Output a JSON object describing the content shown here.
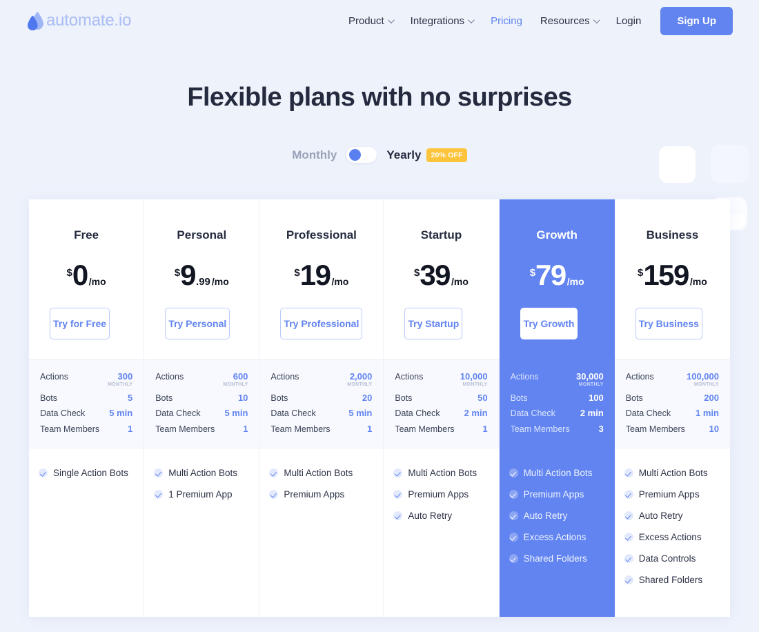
{
  "header": {
    "logo_text": "automate.io",
    "nav": [
      {
        "label": "Product",
        "has_caret": true,
        "active": false
      },
      {
        "label": "Integrations",
        "has_caret": true,
        "active": false
      },
      {
        "label": "Pricing",
        "has_caret": false,
        "active": true
      },
      {
        "label": "Resources",
        "has_caret": true,
        "active": false
      },
      {
        "label": "Login",
        "has_caret": false,
        "active": false
      }
    ],
    "signup_label": "Sign Up"
  },
  "hero": {
    "title": "Flexible plans with no surprises",
    "billing_monthly": "Monthly",
    "billing_yearly": "Yearly",
    "discount_badge": "20% OFF"
  },
  "colors": {
    "accent": "#6184f0",
    "badge": "#fcc43a",
    "page_bg": "#eef2fb",
    "stats_bg": "#f7f9fe",
    "title": "#252b3f"
  },
  "plans": [
    {
      "name": "Free",
      "currency": "$",
      "amount": "0",
      "cents": "",
      "period": "/mo",
      "cta": "Try for Free",
      "featured": false,
      "stats": [
        {
          "label": "Actions",
          "value": "300",
          "sub": "MONTHLY"
        },
        {
          "label": "Bots",
          "value": "5",
          "sub": ""
        },
        {
          "label": "Data Check",
          "value": "5 min",
          "sub": ""
        },
        {
          "label": "Team Members",
          "value": "1",
          "sub": ""
        }
      ],
      "features": [
        "Single Action Bots"
      ]
    },
    {
      "name": "Personal",
      "currency": "$",
      "amount": "9",
      "cents": ".99",
      "period": "/mo",
      "cta": "Try Personal",
      "featured": false,
      "stats": [
        {
          "label": "Actions",
          "value": "600",
          "sub": "MONTHLY"
        },
        {
          "label": "Bots",
          "value": "10",
          "sub": ""
        },
        {
          "label": "Data Check",
          "value": "5 min",
          "sub": ""
        },
        {
          "label": "Team Members",
          "value": "1",
          "sub": ""
        }
      ],
      "features": [
        "Multi Action Bots",
        "1 Premium App"
      ]
    },
    {
      "name": "Professional",
      "currency": "$",
      "amount": "19",
      "cents": "",
      "period": "/mo",
      "cta": "Try Professional",
      "featured": false,
      "stats": [
        {
          "label": "Actions",
          "value": "2,000",
          "sub": "MONTHLY"
        },
        {
          "label": "Bots",
          "value": "20",
          "sub": ""
        },
        {
          "label": "Data Check",
          "value": "5 min",
          "sub": ""
        },
        {
          "label": "Team Members",
          "value": "1",
          "sub": ""
        }
      ],
      "features": [
        "Multi Action Bots",
        "Premium Apps"
      ]
    },
    {
      "name": "Startup",
      "currency": "$",
      "amount": "39",
      "cents": "",
      "period": "/mo",
      "cta": "Try Startup",
      "featured": false,
      "stats": [
        {
          "label": "Actions",
          "value": "10,000",
          "sub": "MONTHLY"
        },
        {
          "label": "Bots",
          "value": "50",
          "sub": ""
        },
        {
          "label": "Data Check",
          "value": "2 min",
          "sub": ""
        },
        {
          "label": "Team Members",
          "value": "1",
          "sub": ""
        }
      ],
      "features": [
        "Multi Action Bots",
        "Premium Apps",
        "Auto Retry"
      ]
    },
    {
      "name": "Growth",
      "currency": "$",
      "amount": "79",
      "cents": "",
      "period": "/mo",
      "cta": "Try Growth",
      "featured": true,
      "stats": [
        {
          "label": "Actions",
          "value": "30,000",
          "sub": "MONTHLY"
        },
        {
          "label": "Bots",
          "value": "100",
          "sub": ""
        },
        {
          "label": "Data Check",
          "value": "2 min",
          "sub": ""
        },
        {
          "label": "Team Members",
          "value": "3",
          "sub": ""
        }
      ],
      "features": [
        "Multi Action Bots",
        "Premium Apps",
        "Auto Retry",
        "Excess Actions",
        "Shared Folders"
      ]
    },
    {
      "name": "Business",
      "currency": "$",
      "amount": "159",
      "cents": "",
      "period": "/mo",
      "cta": "Try Business",
      "featured": false,
      "stats": [
        {
          "label": "Actions",
          "value": "100,000",
          "sub": "MONTHLY"
        },
        {
          "label": "Bots",
          "value": "200",
          "sub": ""
        },
        {
          "label": "Data Check",
          "value": "1 min",
          "sub": ""
        },
        {
          "label": "Team Members",
          "value": "10",
          "sub": ""
        }
      ],
      "features": [
        "Multi Action Bots",
        "Premium Apps",
        "Auto Retry",
        "Excess Actions",
        "Data Controls",
        "Shared Folders"
      ]
    }
  ]
}
